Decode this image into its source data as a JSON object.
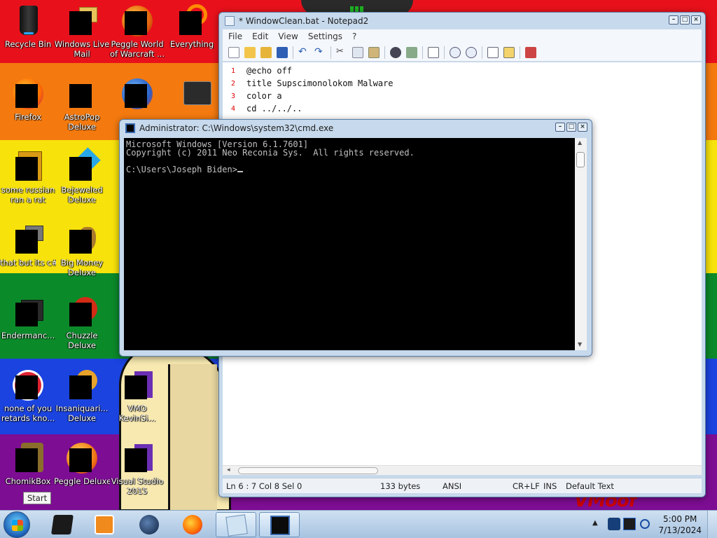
{
  "desktop": {
    "icons": [
      {
        "label": "Recycle Bin"
      },
      {
        "label": "Windows Live Mail"
      },
      {
        "label": "Peggle World of Warcraft ..."
      },
      {
        "label": "Everything"
      },
      {
        "label": "Firefox"
      },
      {
        "label": "AstroPop Deluxe"
      },
      {
        "label": "some russian ran a rat"
      },
      {
        "label": "Bejeweled Deluxe"
      },
      {
        "label": "that but its c#"
      },
      {
        "label": "Big Money Deluxe"
      },
      {
        "label": "Endermanc..."
      },
      {
        "label": "Chuzzle Deluxe"
      },
      {
        "label": "none of you retards kno..."
      },
      {
        "label": "Insaniquari... Deluxe"
      },
      {
        "label": "VMO KevinSi..."
      },
      {
        "label": "ChomikBox"
      },
      {
        "label": "Peggle Deluxe"
      },
      {
        "label": "Visual Studio 2015"
      }
    ],
    "wallpaper_text": "VMoof"
  },
  "notepad": {
    "title": "* WindowClean.bat - Notepad2",
    "menu": [
      "File",
      "Edit",
      "View",
      "Settings",
      "?"
    ],
    "lines": [
      {
        "num": "1",
        "text": "@echo off"
      },
      {
        "num": "2",
        "text": "title Supscimonolokom Malware"
      },
      {
        "num": "3",
        "text": "color a"
      },
      {
        "num": "4",
        "text": "cd ../../.."
      }
    ],
    "status": {
      "position": "Ln 6 : 7   Col 8   Sel 0",
      "bytes": "133 bytes",
      "encoding": "ANSI",
      "line_endings": "CR+LF",
      "ins": "INS",
      "scheme": "Default Text"
    }
  },
  "cmd": {
    "title": "Administrator: C:\\Windows\\system32\\cmd.exe",
    "output": "Microsoft Windows [Version 6.1.7601]\nCopyright (c) 2011 Neo Reconia Sys.  All rights reserved.\n\nC:\\Users\\Joseph Biden>"
  },
  "taskbar": {
    "start_tooltip": "Start",
    "time": "5:00 PM",
    "date": "7/13/2024"
  },
  "colors": {
    "console_bg": "#000000",
    "console_text": "#c0c0c0",
    "line_number": "#dd0000"
  }
}
